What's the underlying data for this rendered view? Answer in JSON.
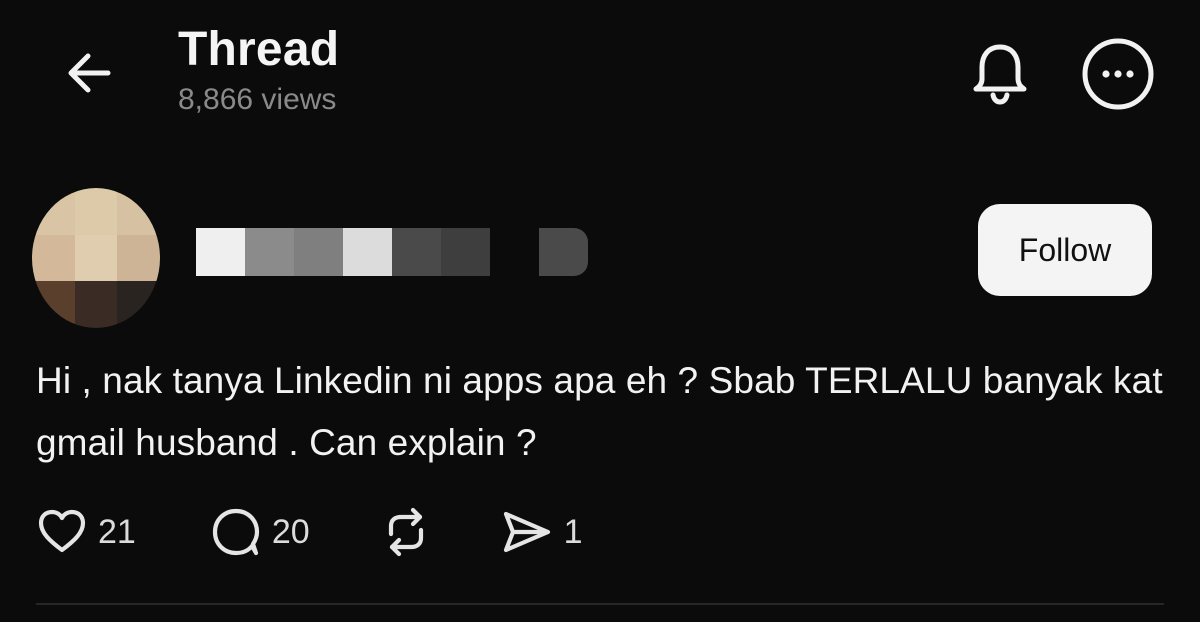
{
  "header": {
    "title": "Thread",
    "views": "8,866 views",
    "back_icon": "arrow-left-icon",
    "bell_icon": "bell-icon",
    "more_icon": "more-horizontal-icon"
  },
  "post": {
    "follow_label": "Follow",
    "text": "Hi , nak tanya Linkedin ni apps apa eh ? Sbab TERLALU banyak kat gmail husband . Can explain ?",
    "likes": "21",
    "replies": "20",
    "shares": "1"
  },
  "colors": {
    "background": "#0b0b0b",
    "follow_button_bg": "#f4f4f4",
    "secondary_text": "#8a8a8a"
  }
}
